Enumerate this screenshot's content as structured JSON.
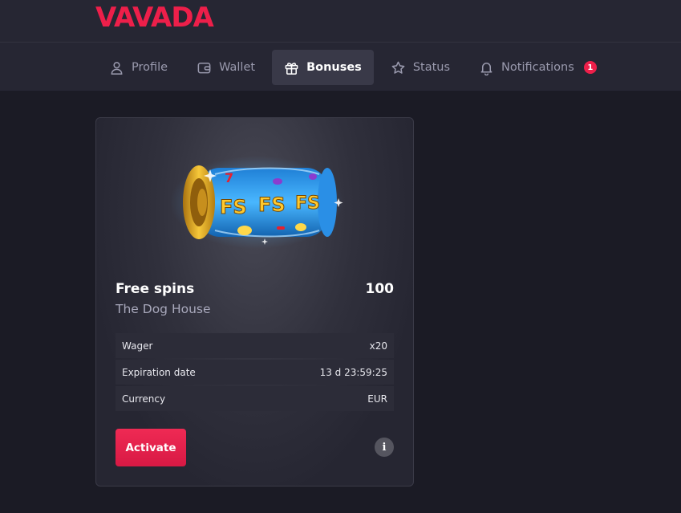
{
  "brand": {
    "logo_text": "VAVADA",
    "accent": "#ed1f4a"
  },
  "nav": {
    "items": [
      {
        "label": "Profile",
        "icon": "user-icon"
      },
      {
        "label": "Wallet",
        "icon": "wallet-icon"
      },
      {
        "label": "Bonuses",
        "icon": "gift-icon",
        "active": true
      },
      {
        "label": "Status",
        "icon": "star-icon"
      },
      {
        "label": "Notifications",
        "icon": "bell-icon",
        "badge": "1"
      }
    ]
  },
  "bonus": {
    "title": "Free spins",
    "amount": "100",
    "game": "The Dog House",
    "image_icon": "free-spins-reel-icon",
    "image_text": [
      "FS",
      "FS",
      "FS"
    ],
    "rows": [
      {
        "label": "Wager",
        "value": "x20"
      },
      {
        "label": "Expiration date",
        "value": "13 d 23:59:25"
      },
      {
        "label": "Currency",
        "value": "EUR"
      }
    ],
    "activate_label": "Activate",
    "info_icon": "info-icon"
  }
}
